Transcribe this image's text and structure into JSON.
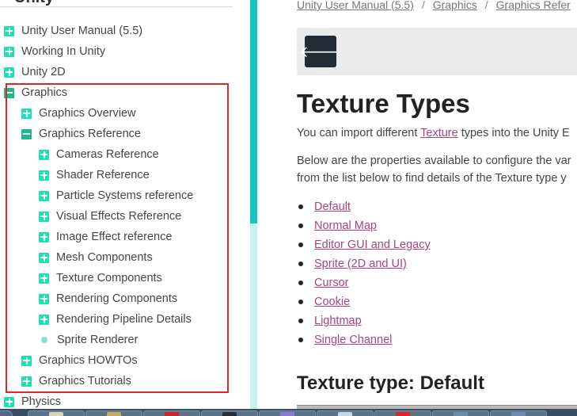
{
  "sidebar": {
    "heading": "Unity",
    "items": [
      {
        "label": "Unity User Manual (5.5)",
        "toggle": "plus"
      },
      {
        "label": "Working In Unity",
        "toggle": "plus"
      },
      {
        "label": "Unity 2D",
        "toggle": "plus"
      },
      {
        "label": "Graphics",
        "toggle": "minus"
      },
      {
        "label": "Graphics Overview",
        "toggle": "plus"
      },
      {
        "label": "Graphics Reference",
        "toggle": "minus"
      },
      {
        "label": "Cameras Reference",
        "toggle": "plus"
      },
      {
        "label": "Shader Reference",
        "toggle": "plus"
      },
      {
        "label": "Particle Systems reference",
        "toggle": "plus"
      },
      {
        "label": "Visual Effects Reference",
        "toggle": "plus"
      },
      {
        "label": "Image Effect reference",
        "toggle": "plus"
      },
      {
        "label": "Mesh Components",
        "toggle": "plus"
      },
      {
        "label": "Texture Components",
        "toggle": "plus"
      },
      {
        "label": "Rendering Components",
        "toggle": "plus"
      },
      {
        "label": "Rendering Pipeline Details",
        "toggle": "plus"
      },
      {
        "label": "Sprite Renderer",
        "toggle": "leaf"
      },
      {
        "label": "Graphics HOWTOs",
        "toggle": "plus"
      },
      {
        "label": "Graphics Tutorials",
        "toggle": "plus"
      },
      {
        "label": "Physics",
        "toggle": "plus"
      }
    ]
  },
  "breadcrumb": [
    "Unity User Manual (5.5)",
    "Graphics",
    "Graphics Refer"
  ],
  "breadcrumb_separator": "/",
  "back_icon": "arrow-left-icon",
  "back_glyph": "🡐",
  "page_title": "Texture Types",
  "intro": {
    "before": "You can import different ",
    "link": "Texture",
    "after": " types into the Unity E"
  },
  "description_line1": "Below are the properties available to configure the var",
  "description_line2": "from the list below to find details of the Texture type y",
  "texture_types": [
    "Default",
    "Normal Map",
    "Editor GUI and Legacy",
    "Sprite (2D and UI)",
    "Cursor",
    "Cookie",
    "Lightmap",
    "Single Channel"
  ],
  "section_heading": "Texture type: Default",
  "colors": {
    "accent": "#19e3b1",
    "accent_dark": "#1cb98f",
    "link": "#a8447e",
    "highlight_border": "#d9272e",
    "scroll_thumb": "#16c6bb",
    "nav_button": "#222c37"
  }
}
